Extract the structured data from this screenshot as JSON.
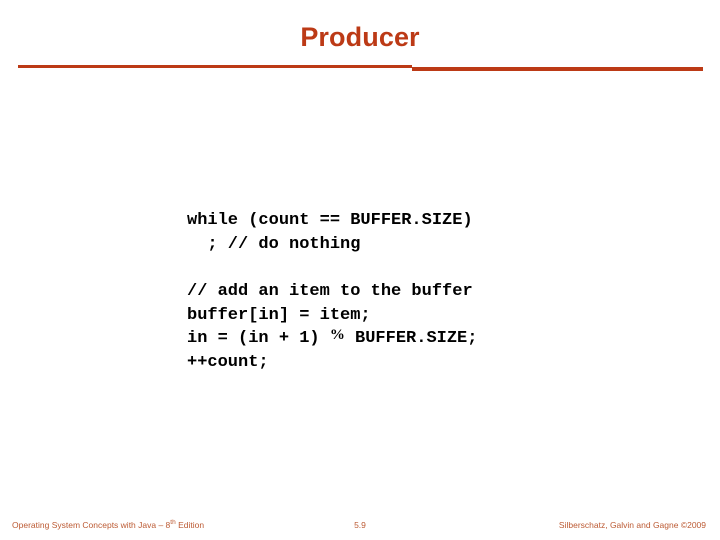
{
  "slide": {
    "title": "Producer",
    "title_color": "#bc3a16",
    "rule_color": "#bc3a16",
    "background_color": "#ffffff",
    "code_color": "#000000"
  },
  "code": {
    "block_1": {
      "lines": [
        "while (count == BUFFER.SIZE)",
        "  ; // do nothing"
      ]
    },
    "block_2": {
      "line_1": "// add an item to the buffer",
      "line_2": "buffer[in] = item;",
      "line_3_before_pct": "in = (in + 1) ",
      "line_3_pct": "%",
      "line_3_after_pct": " BUFFER.SIZE;",
      "line_4": "++count;"
    }
  },
  "footer": {
    "left_text": "Operating System Concepts with Java – 8",
    "left_superscript": "th",
    "left_suffix": " Edition",
    "slide_number": "5.9",
    "right_text": "Silberschatz, Galvin and Gagne ©2009",
    "color": "#bc5a33"
  }
}
